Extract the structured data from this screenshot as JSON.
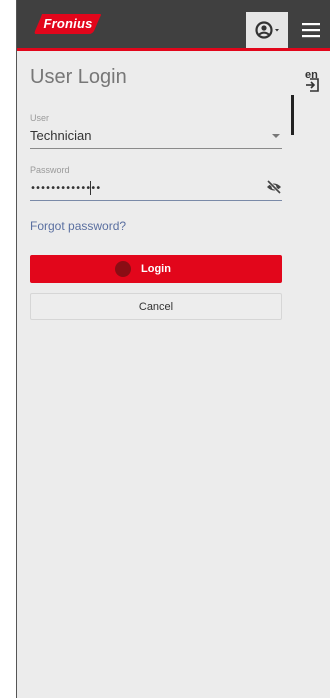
{
  "header": {
    "logo_text": "Fronius",
    "user_icon": "user-circle-icon",
    "menu_icon": "hamburger-menu-icon",
    "brand_color": "#e2061b"
  },
  "login": {
    "title": "User Login",
    "user_label": "User",
    "user_value": "Technician",
    "password_label": "Password",
    "password_value": "••••••••••••••",
    "toggle_visibility_icon": "eye-slash-icon",
    "forgot_password": "Forgot password?",
    "login_label": "Login",
    "cancel_label": "Cancel"
  },
  "side": {
    "language": "en",
    "login_icon": "sign-in-icon"
  }
}
